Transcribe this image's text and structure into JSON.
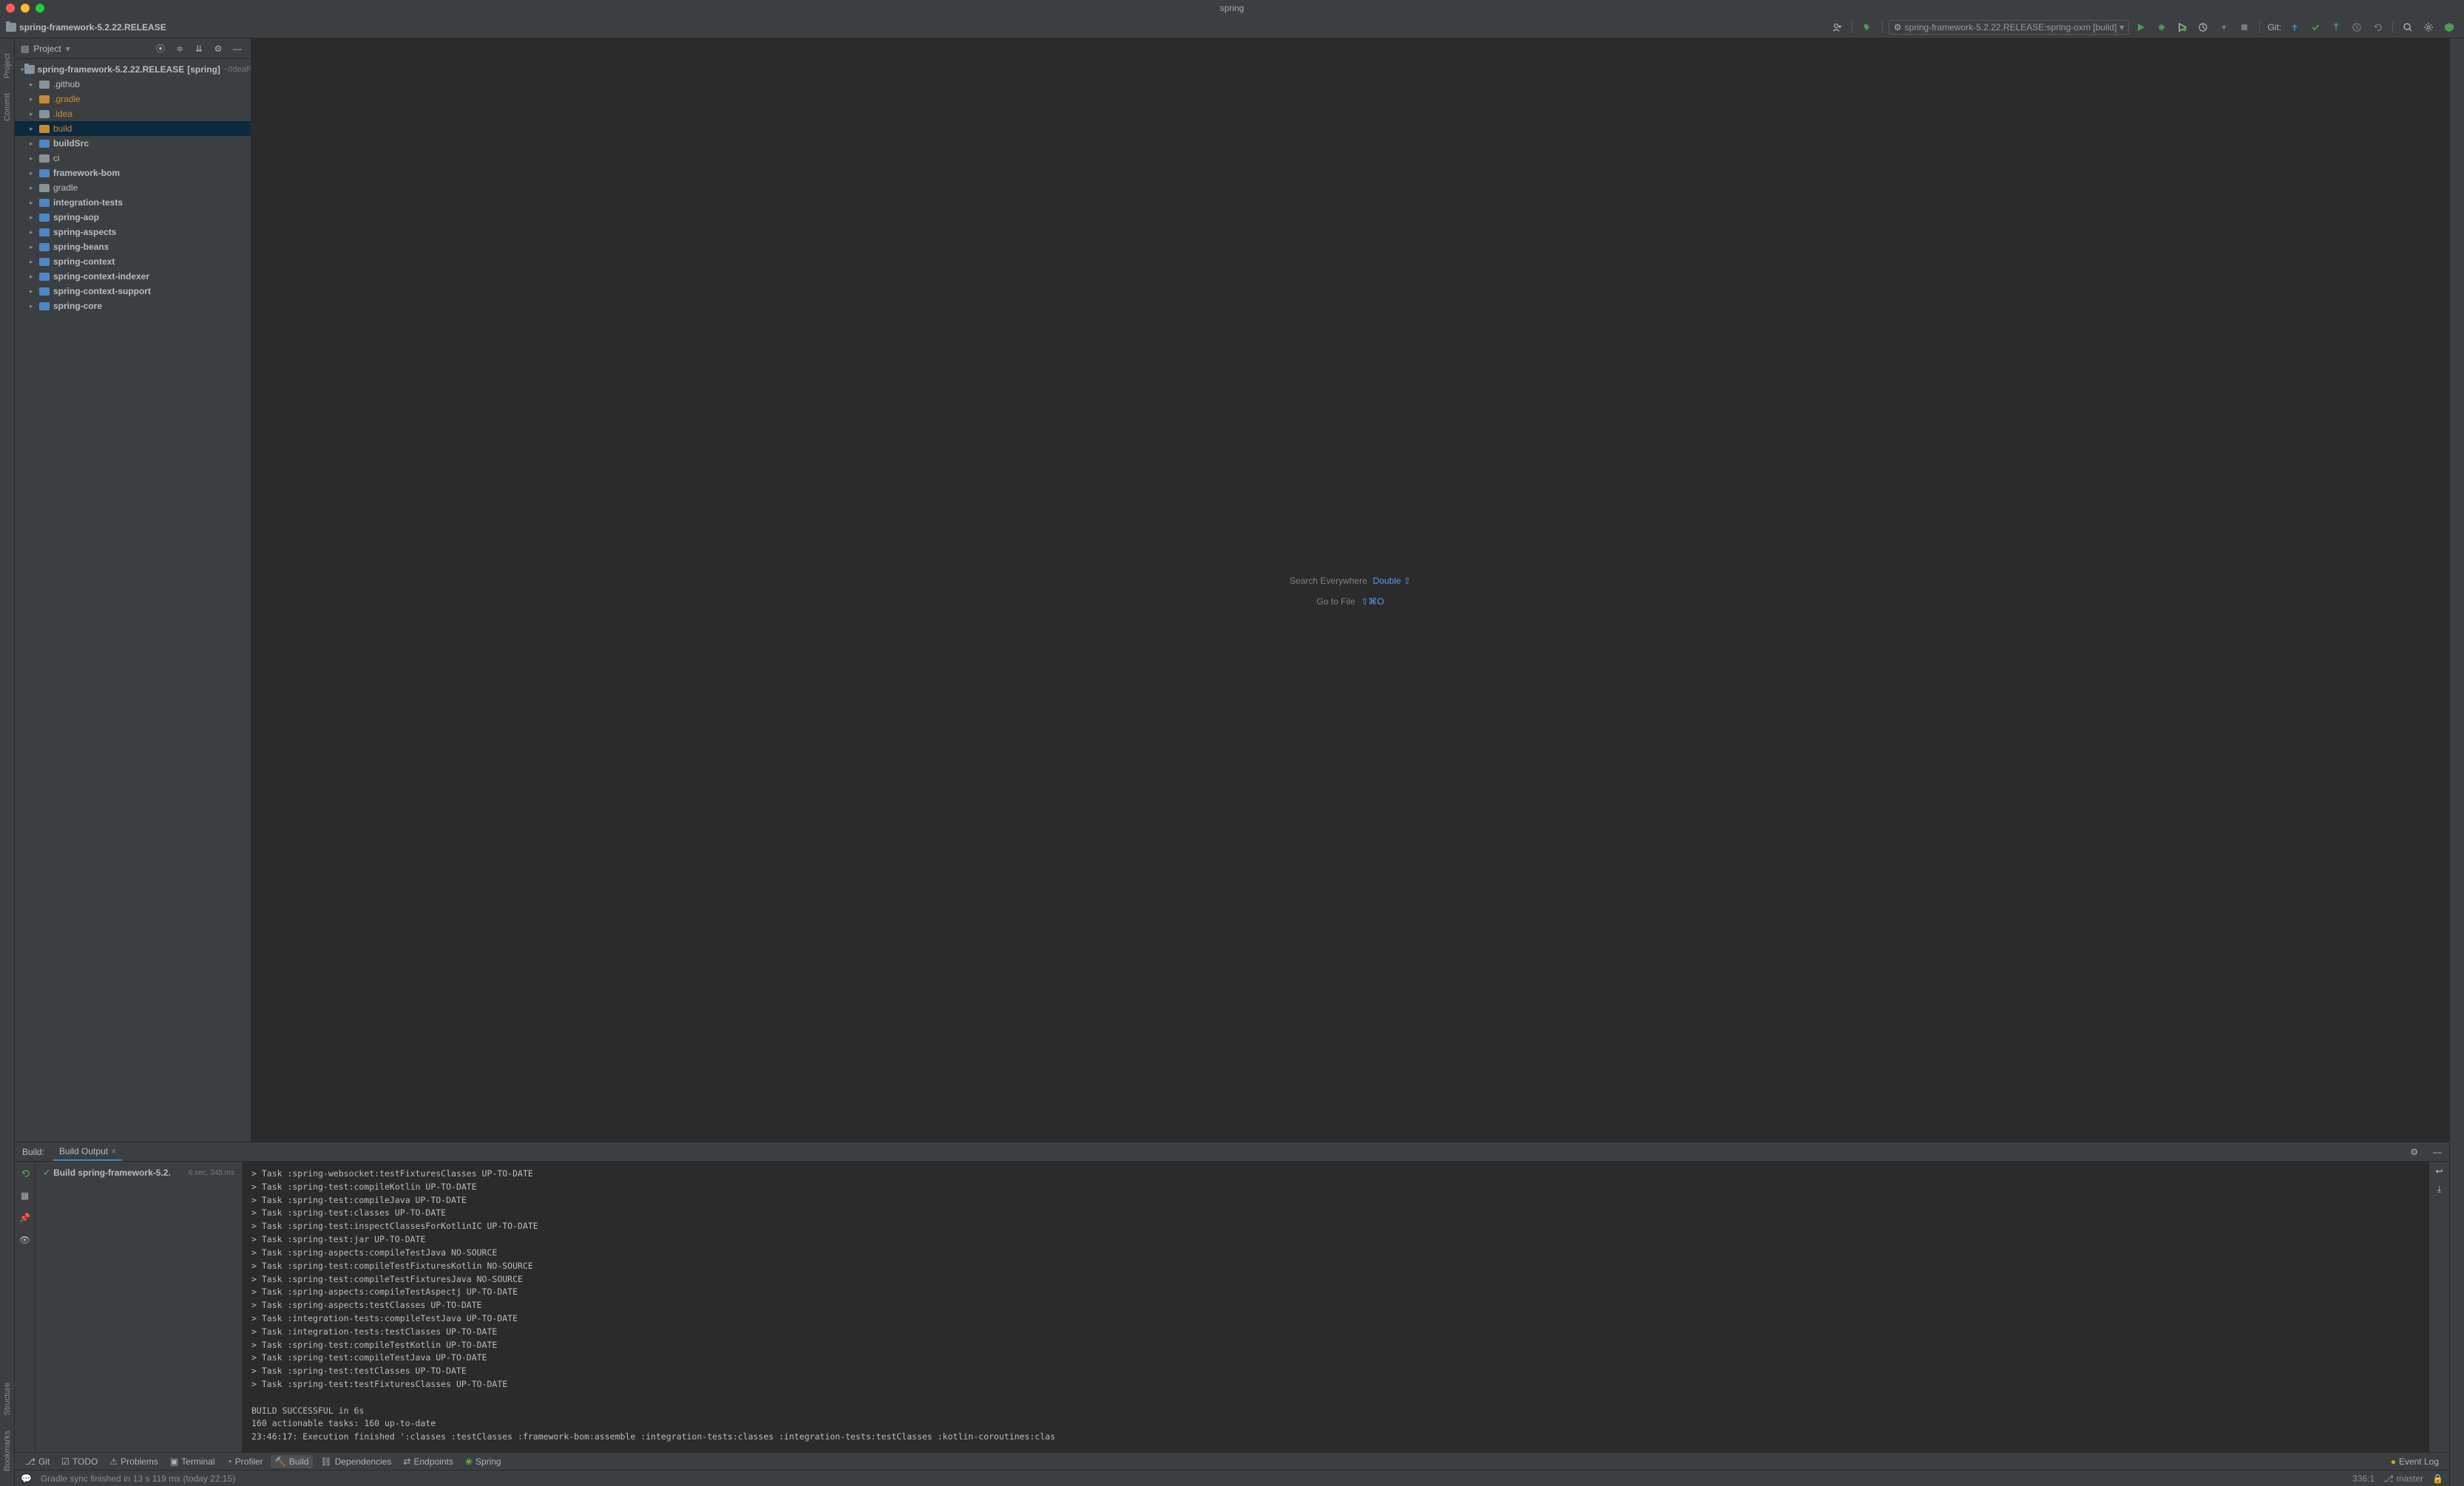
{
  "window": {
    "title": "spring"
  },
  "breadcrumb": {
    "project": "spring-framework-5.2.22.RELEASE"
  },
  "runConfig": {
    "label": "spring-framework-5.2.22.RELEASE:spring-oxm [build]"
  },
  "git": {
    "label": "Git:"
  },
  "leftGutter": {
    "project": "Project",
    "commit": "Commit",
    "structure": "Structure",
    "bookmarks": "Bookmarks"
  },
  "projectPanel": {
    "title": "Project"
  },
  "tree": {
    "root": "spring-framework-5.2.22.RELEASE",
    "rootBracket": "[spring]",
    "rootPath": "~/IdeaP",
    "items": [
      {
        "label": ".github",
        "icon": "gray",
        "bold": false,
        "excluded": false
      },
      {
        "label": ".gradle",
        "icon": "orange",
        "bold": false,
        "excluded": true
      },
      {
        "label": ".idea",
        "icon": "gray",
        "bold": false,
        "excluded": true
      },
      {
        "label": "build",
        "icon": "orange",
        "bold": false,
        "excluded": true,
        "selected": true
      },
      {
        "label": "buildSrc",
        "icon": "blue",
        "bold": true,
        "excluded": false
      },
      {
        "label": "ci",
        "icon": "gray",
        "bold": false,
        "excluded": false
      },
      {
        "label": "framework-bom",
        "icon": "blue",
        "bold": true,
        "excluded": false
      },
      {
        "label": "gradle",
        "icon": "gray",
        "bold": false,
        "excluded": false
      },
      {
        "label": "integration-tests",
        "icon": "blue",
        "bold": true,
        "excluded": false
      },
      {
        "label": "spring-aop",
        "icon": "blue",
        "bold": true,
        "excluded": false
      },
      {
        "label": "spring-aspects",
        "icon": "blue",
        "bold": true,
        "excluded": false
      },
      {
        "label": "spring-beans",
        "icon": "blue",
        "bold": true,
        "excluded": false
      },
      {
        "label": "spring-context",
        "icon": "blue",
        "bold": true,
        "excluded": false
      },
      {
        "label": "spring-context-indexer",
        "icon": "blue",
        "bold": true,
        "excluded": false
      },
      {
        "label": "spring-context-support",
        "icon": "blue",
        "bold": true,
        "excluded": false
      },
      {
        "label": "spring-core",
        "icon": "blue",
        "bold": true,
        "excluded": false
      }
    ]
  },
  "editor": {
    "searchEverywhere": "Search Everywhere",
    "searchKey": "Double ⇧",
    "goToFile": "Go to File",
    "goToFileKey": "⇧⌘O"
  },
  "build": {
    "label": "Build:",
    "tab": "Build Output",
    "task": "Build spring-framework-5.2.",
    "taskTime": "6 sec, 345 ms",
    "lines": [
      "> Task :spring-websocket:testFixturesClasses UP-TO-DATE",
      "> Task :spring-test:compileKotlin UP-TO-DATE",
      "> Task :spring-test:compileJava UP-TO-DATE",
      "> Task :spring-test:classes UP-TO-DATE",
      "> Task :spring-test:inspectClassesForKotlinIC UP-TO-DATE",
      "> Task :spring-test:jar UP-TO-DATE",
      "> Task :spring-aspects:compileTestJava NO-SOURCE",
      "> Task :spring-test:compileTestFixturesKotlin NO-SOURCE",
      "> Task :spring-test:compileTestFixturesJava NO-SOURCE",
      "> Task :spring-aspects:compileTestAspectj UP-TO-DATE",
      "> Task :spring-aspects:testClasses UP-TO-DATE",
      "> Task :integration-tests:compileTestJava UP-TO-DATE",
      "> Task :integration-tests:testClasses UP-TO-DATE",
      "> Task :spring-test:compileTestKotlin UP-TO-DATE",
      "> Task :spring-test:compileTestJava UP-TO-DATE",
      "> Task :spring-test:testClasses UP-TO-DATE",
      "> Task :spring-test:testFixturesClasses UP-TO-DATE",
      "",
      "BUILD SUCCESSFUL in 6s",
      "160 actionable tasks: 160 up-to-date",
      "23:46:17: Execution finished ':classes :testClasses :framework-bom:assemble :integration-tests:classes :integration-tests:testClasses :kotlin-coroutines:clas"
    ]
  },
  "bottomTabs": {
    "git": "Git",
    "todo": "TODO",
    "problems": "Problems",
    "terminal": "Terminal",
    "profiler": "Profiler",
    "build": "Build",
    "dependencies": "Dependencies",
    "endpoints": "Endpoints",
    "spring": "Spring",
    "eventLog": "Event Log"
  },
  "status": {
    "message": "Gradle sync finished in 13 s 119 ms (today 22:15)",
    "cursor": "336:1",
    "branch": "master"
  }
}
